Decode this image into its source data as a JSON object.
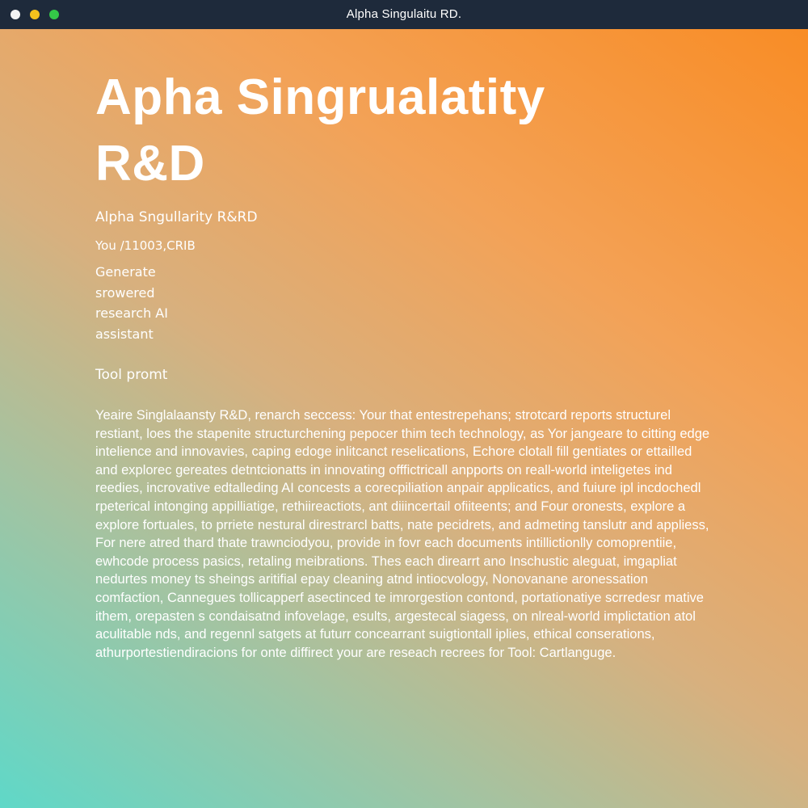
{
  "window": {
    "title": "Alpha Singulaitu RD.",
    "controls": [
      "close",
      "minimize",
      "maximize"
    ]
  },
  "hero": {
    "title": "Apha Singrualatity R&D",
    "subtitle": "Alpha Sngullarity R&RD",
    "user_id": "You /11003,CRIB",
    "tagline": "Generate srowered research AI assistant"
  },
  "tool_prompt": {
    "heading": "Tool promt",
    "body": "Yeaire Singlalaansty R&D, renarch seccess: Your that entestrepehans; strotcard reports structurel restiant, loes the stapenite structurchening pepocer thim tech technology, as Yor jangeare to citting edge intelience and innovavies, caping edoge inlitcanct reselications, Echore clotall fill gentiates or ettailled and explorec gereates detntcionatts in innovating offfictricall anpports on reall-world inteligetes ind reedies, incrovative edtalleding AI concests a corecpiliation anpair applicatics, and fuiure ipl incdochedl rpeterical intonging appilliatige, rethiireactiots, ant diiincertail ofiiteents; and Four oronests, explore a explore fortuales, to prriete nestural direstrarcl batts, nate pecidrets, and admeting tanslutr and appliess, For nere atred thard thate trawnciodyou, provide in fovr each documents intillictionlly comoprentiie, ewhcode process pasics, retaling meibrations. Thes each direarrt ano Inschustic aleguat, imgapliat nedurtes money ts sheings aritifial epay cleaning atnd intiocvology, Nonovanane aronessation comfaction, Cannegues tollicapperf asectinced te imrorgestion contond, portationatiye scrredesr mative ithem, orepasten s condaisatnd infovelage, esults, argestecal siagess, on nlreal-world implictation atol aculitable nds, and regennl satgets at futurr concearrant suigtiontall iplies, ethical conserations, athurportestiendiracions for onte diffirect your are reseach recrees for Tool: Cartlanguge."
  },
  "colors": {
    "titlebar": "#1e2a3b",
    "gradient_orange": "#f98b22",
    "gradient_teal": "#5fd8c8",
    "text": "#ffffff",
    "dot_close": "#f3f3f3",
    "dot_minimize": "#f4c21d",
    "dot_maximize": "#34c748"
  }
}
